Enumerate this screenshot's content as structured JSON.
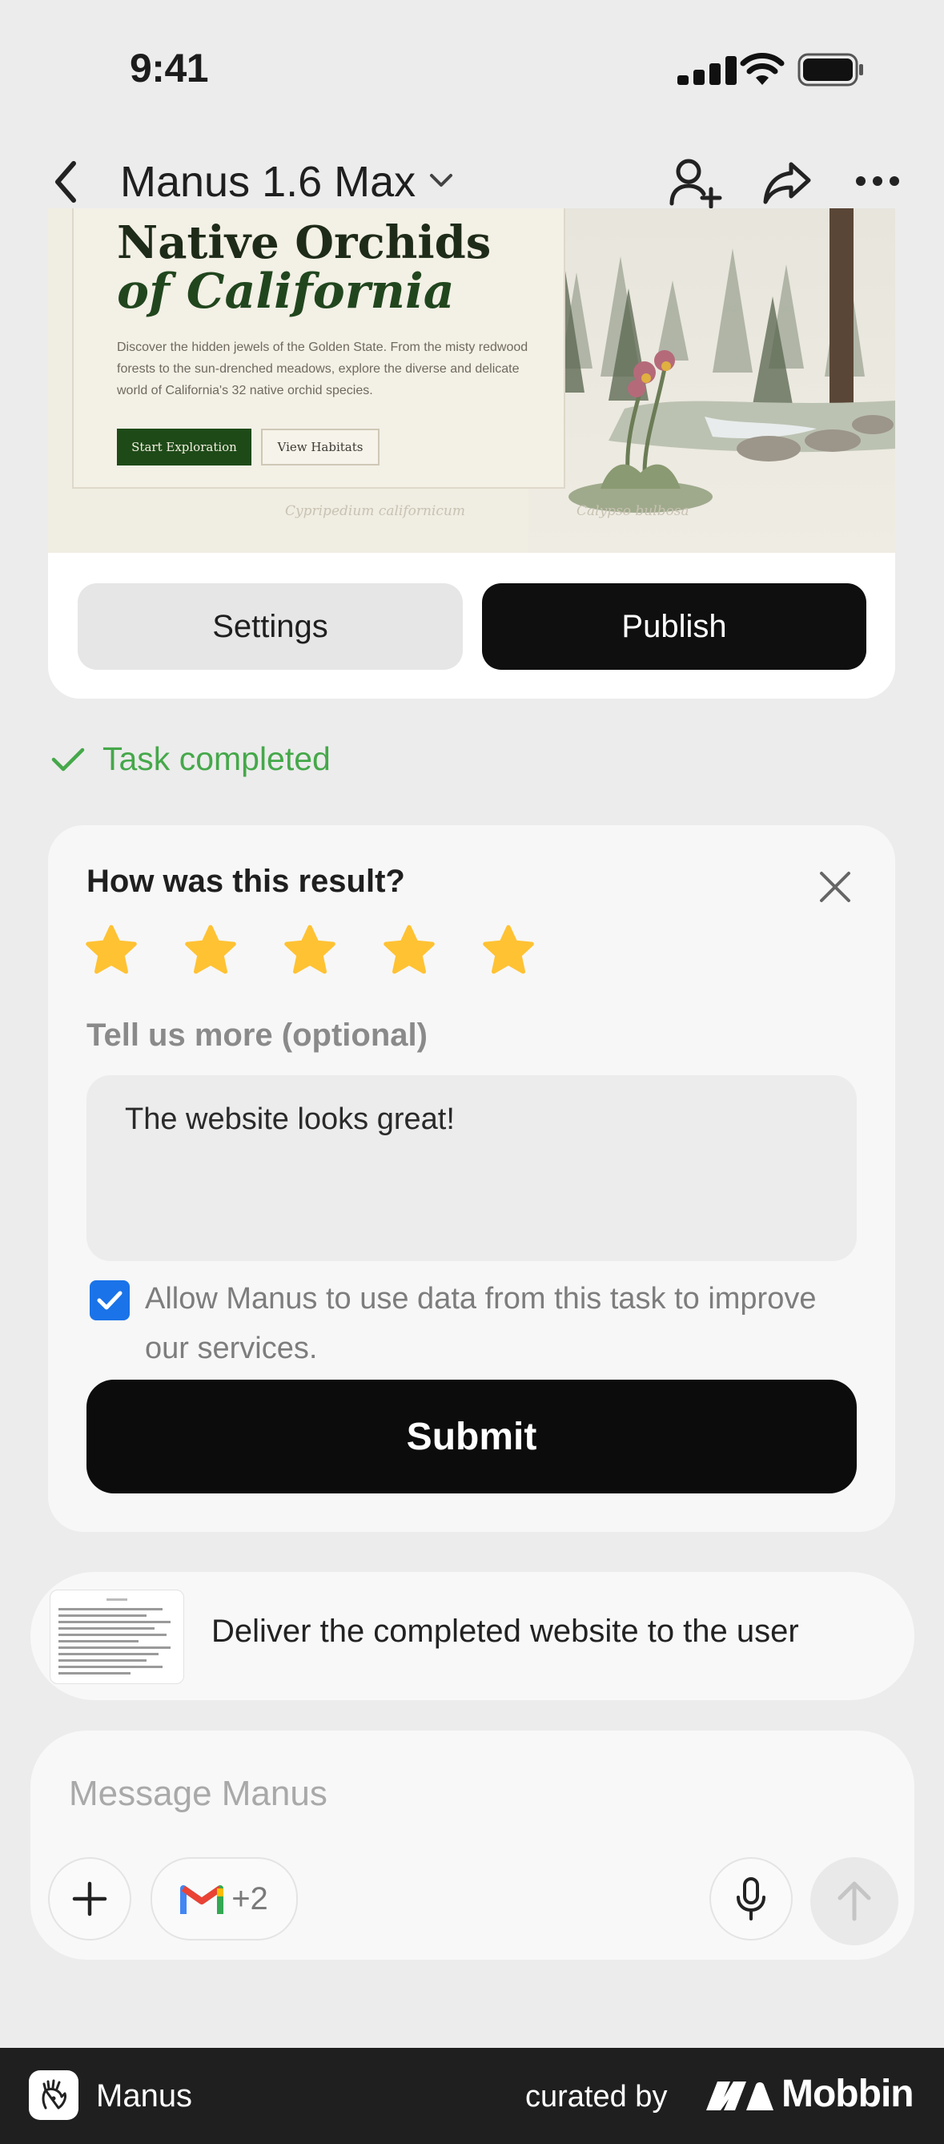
{
  "status_bar": {
    "time": "9:41"
  },
  "nav": {
    "title": "Manus 1.6 Max"
  },
  "preview": {
    "hero_title_1": "Native Orchids",
    "hero_title_2": "of California",
    "hero_paragraph": "Discover the hidden jewels of the Golden State. From the misty redwood forests to the sun-drenched meadows, explore the diverse and delicate world of California's 32 native orchid species.",
    "btn_primary": "Start Exploration",
    "btn_secondary": "View Habitats",
    "caption_left": "Cypripedium californicum",
    "caption_right": "Calypso bulbosa"
  },
  "actions": {
    "settings": "Settings",
    "publish": "Publish"
  },
  "task_status": "Task completed",
  "feedback": {
    "question": "How was this result?",
    "rating": 5,
    "rating_max": 5,
    "more_label": "Tell us more (optional)",
    "text": "The website looks great!",
    "consent": "Allow Manus to use data from this task to improve our services.",
    "consent_checked": true,
    "submit": "Submit",
    "star_color": "#FFC233"
  },
  "step": {
    "text": "Deliver the completed website to the user"
  },
  "composer": {
    "placeholder": "Message Manus",
    "connector_count": "+2"
  },
  "footer": {
    "app_name": "Manus",
    "curated_by": "curated by",
    "brand": "Mobbin"
  }
}
